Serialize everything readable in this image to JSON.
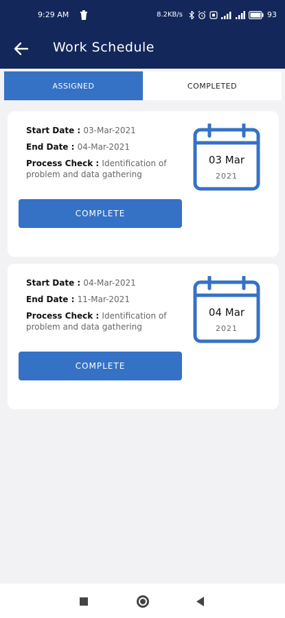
{
  "status_bar": {
    "time": "9:29 AM",
    "net_speed": "8.2KB/s",
    "battery": "93"
  },
  "header": {
    "title": "Work Schedule"
  },
  "tabs": [
    {
      "label": "ASSIGNED",
      "active": true
    },
    {
      "label": "COMPLETED",
      "active": false
    }
  ],
  "labels": {
    "start_date": "Start Date : ",
    "end_date": "End Date : ",
    "process_check": "Process Check : ",
    "complete_button": "COMPLETE"
  },
  "cards": [
    {
      "start_date": "03-Mar-2021",
      "end_date": "04-Mar-2021",
      "process_check": "Identification of problem and data gathering",
      "cal_day": "03 Mar",
      "cal_year": "2021"
    },
    {
      "start_date": "04-Mar-2021",
      "end_date": "11-Mar-2021",
      "process_check": "Identification of problem and data gathering",
      "cal_day": "04 Mar",
      "cal_year": "2021"
    }
  ],
  "colors": {
    "header": "#13275a",
    "accent": "#3572c6",
    "background": "#f2f2f4"
  }
}
